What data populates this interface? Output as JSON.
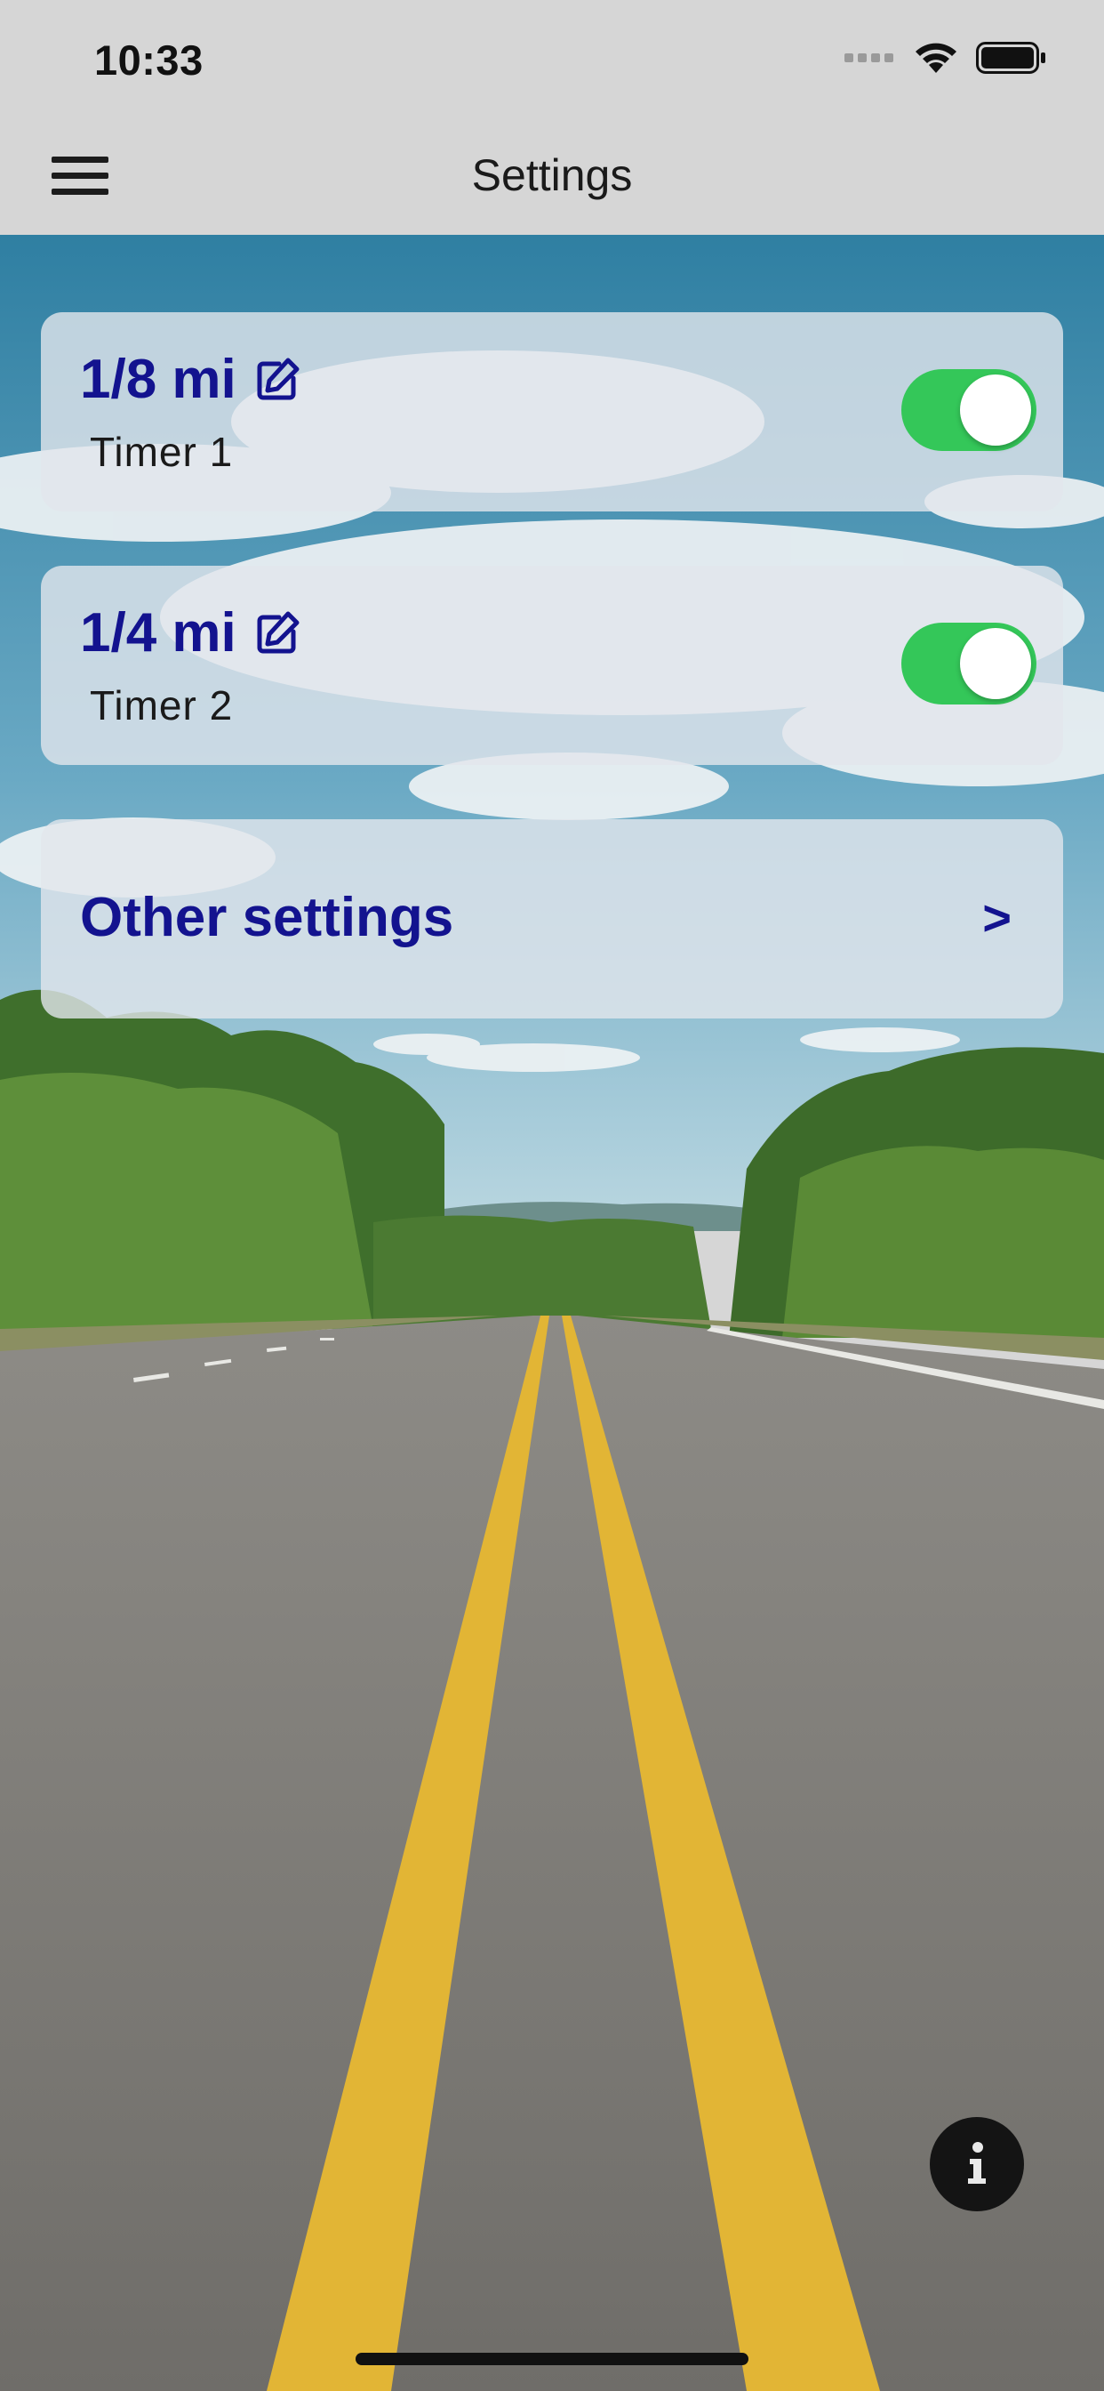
{
  "status_bar": {
    "time": "10:33"
  },
  "nav": {
    "title": "Settings"
  },
  "timers": [
    {
      "distance": "1/8 mi",
      "label": "Timer 1",
      "enabled": true
    },
    {
      "distance": "1/4 mi",
      "label": "Timer 2",
      "enabled": true
    }
  ],
  "other_settings": {
    "label": "Other settings",
    "chevron": ">"
  },
  "icons": {
    "menu": "hamburger-menu-icon",
    "edit": "edit-pencil-icon",
    "info": "info-icon",
    "wifi": "wifi-icon",
    "battery": "battery-icon",
    "signal": "cellular-signal-icon"
  },
  "colors": {
    "accent": "#13138f",
    "toggle_on": "#34c759",
    "bar_background": "#d6d6d6"
  }
}
